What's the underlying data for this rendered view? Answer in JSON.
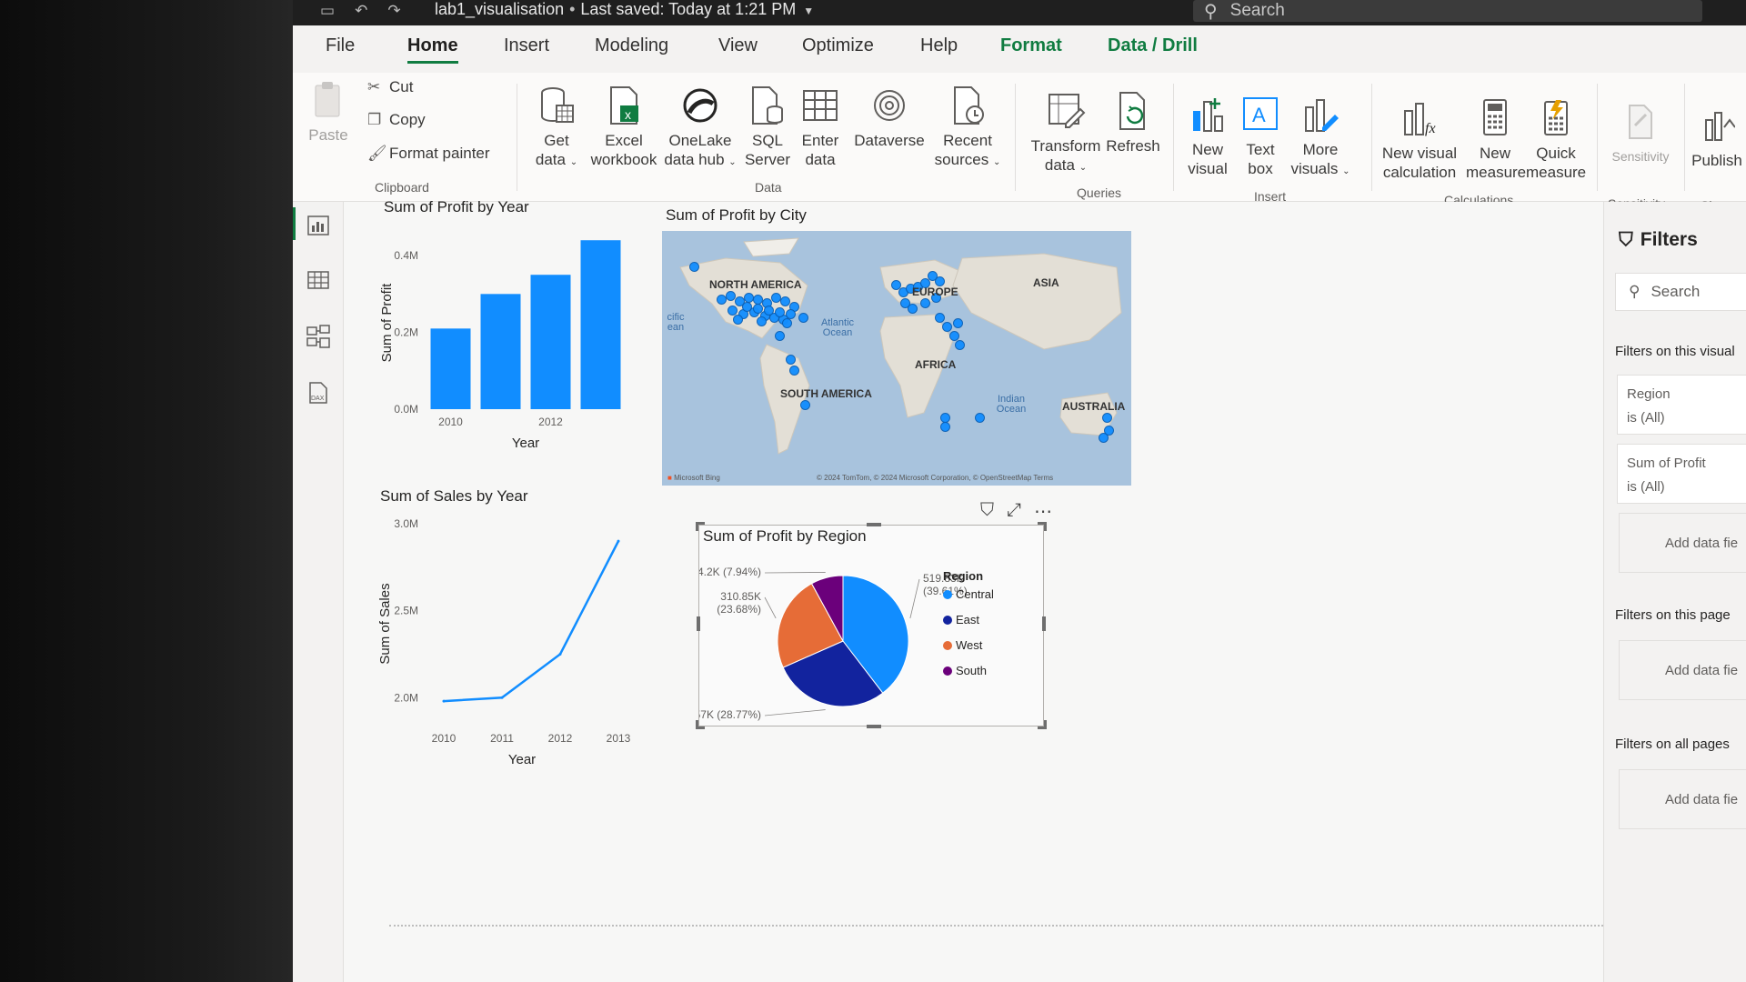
{
  "titlebar": {
    "file_name": "lab1_visualisation",
    "separator": "•",
    "saved_status": "Last saved: Today at 1:21 PM",
    "search_placeholder": "Search"
  },
  "tabs": [
    "File",
    "Home",
    "Insert",
    "Modeling",
    "View",
    "Optimize",
    "Help",
    "Format",
    "Data / Drill"
  ],
  "ribbon": {
    "clipboard": {
      "paste": "Paste",
      "cut": "Cut",
      "copy": "Copy",
      "format_painter": "Format painter",
      "group": "Clipboard"
    },
    "data": {
      "get_data": [
        "Get",
        "data"
      ],
      "excel": [
        "Excel",
        "workbook"
      ],
      "onelake": [
        "OneLake",
        "data hub"
      ],
      "sql": [
        "SQL",
        "Server"
      ],
      "enter": [
        "Enter",
        "data"
      ],
      "dataverse": "Dataverse",
      "recent": [
        "Recent",
        "sources"
      ],
      "group": "Data"
    },
    "queries": {
      "transform": [
        "Transform",
        "data"
      ],
      "refresh": "Refresh",
      "group": "Queries"
    },
    "insert": {
      "new_visual": [
        "New",
        "visual"
      ],
      "text_box": [
        "Text",
        "box"
      ],
      "more_visuals": [
        "More",
        "visuals"
      ],
      "group": "Insert"
    },
    "calculations": {
      "new_visual_calc": [
        "New visual",
        "calculation"
      ],
      "new_measure": [
        "New",
        "measure"
      ],
      "quick_measure": [
        "Quick",
        "measure"
      ],
      "group": "Calculations"
    },
    "sensitivity": {
      "label": "Sensitivity",
      "group": "Sensitivity"
    },
    "share": {
      "publish": "Publish",
      "group": "Share"
    }
  },
  "chart_data": [
    {
      "type": "bar",
      "title": "Sum of Profit by Year",
      "xlabel": "Year",
      "ylabel": "Sum of Profit",
      "categories": [
        "2010",
        "2011",
        "2012",
        "2013"
      ],
      "x_tick_labels": [
        "2010",
        "2012"
      ],
      "values": [
        0.21,
        0.3,
        0.35,
        0.44
      ],
      "unit": "M",
      "y_ticks": [
        "0.0M",
        "0.2M",
        "0.4M"
      ],
      "ylim": [
        0,
        0.45
      ],
      "color": "#118DFF"
    },
    {
      "type": "line",
      "title": "Sum of Sales by Year",
      "xlabel": "Year",
      "ylabel": "Sum of Sales",
      "x": [
        "2010",
        "2011",
        "2012",
        "2013"
      ],
      "values": [
        1.98,
        2.0,
        2.25,
        2.9
      ],
      "unit": "M",
      "y_ticks": [
        "2.0M",
        "2.5M",
        "3.0M"
      ],
      "ylim": [
        1.85,
        3.0
      ],
      "color": "#118DFF"
    },
    {
      "type": "pie",
      "title": "Sum of Profit by Region",
      "legend_title": "Region",
      "legend_position": "right",
      "slices": [
        {
          "label": "Central",
          "value": 519.83,
          "text": "519.83K",
          "pct": "(39.61%)",
          "color": "#118DFF"
        },
        {
          "label": "East",
          "value": 377.57,
          "text": "377.57K (28.77%)",
          "pct": "",
          "color": "#12239E"
        },
        {
          "label": "West",
          "value": 310.85,
          "text": "310.85K",
          "pct": "(23.68%)",
          "color": "#E66C37"
        },
        {
          "label": "South",
          "value": 104.2,
          "text": "104.2K (7.94%)",
          "pct": "",
          "color": "#6B007B"
        }
      ]
    }
  ],
  "map": {
    "title": "Sum of Profit by City",
    "labels": [
      "NORTH AMERICA",
      "EUROPE",
      "ASIA",
      "AFRICA",
      "SOUTH AMERICA",
      "AUSTRALIA"
    ],
    "oceans": [
      "Atlantic Ocean",
      "Indian Ocean",
      "cific ean"
    ],
    "provider": "Microsoft Bing",
    "credit": "© 2024 TomTom, © 2024 Microsoft Corporation, © OpenStreetMap  Terms"
  },
  "filters": {
    "title": "Filters",
    "search": "Search",
    "on_visual": "Filters on this visual",
    "cards": [
      {
        "field": "Region",
        "state": "is (All)"
      },
      {
        "field": "Sum of Profit",
        "state": "is (All)"
      }
    ],
    "add_label": "Add data fie",
    "on_page": "Filters on this page",
    "on_all": "Filters on all pages"
  },
  "colors": {
    "accent": "#107c41",
    "series": "#118DFF"
  }
}
